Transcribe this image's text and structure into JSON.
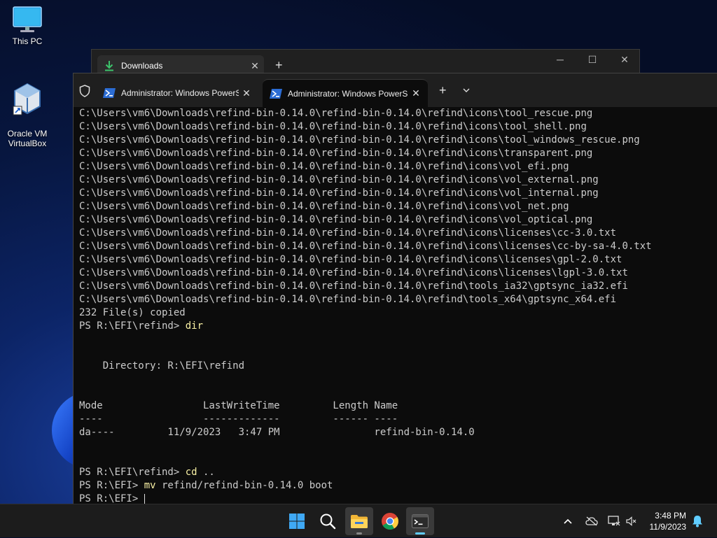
{
  "desktop": {
    "icons": [
      {
        "label": "This PC",
        "icon": "monitor-icon"
      },
      {
        "label": "Oracle VM\nVirtualBox",
        "icon": "virtualbox-icon"
      }
    ]
  },
  "explorer_window": {
    "tab_title": "Downloads",
    "tab_icon": "download-icon",
    "controls": {
      "minimize": "─",
      "maximize": "☐",
      "close": "✕"
    }
  },
  "terminal": {
    "tabs": [
      {
        "title": "Administrator: Windows PowerShell",
        "active": false
      },
      {
        "title": "Administrator: Windows PowerShell",
        "active": true
      }
    ],
    "new_tab_label": "+",
    "dropdown_label": "⌄",
    "lines": [
      {
        "text": "C:\\Users\\vm6\\Downloads\\refind-bin-0.14.0\\refind-bin-0.14.0\\refind\\icons\\tool_rescue.png"
      },
      {
        "text": "C:\\Users\\vm6\\Downloads\\refind-bin-0.14.0\\refind-bin-0.14.0\\refind\\icons\\tool_shell.png"
      },
      {
        "text": "C:\\Users\\vm6\\Downloads\\refind-bin-0.14.0\\refind-bin-0.14.0\\refind\\icons\\tool_windows_rescue.png"
      },
      {
        "text": "C:\\Users\\vm6\\Downloads\\refind-bin-0.14.0\\refind-bin-0.14.0\\refind\\icons\\transparent.png"
      },
      {
        "text": "C:\\Users\\vm6\\Downloads\\refind-bin-0.14.0\\refind-bin-0.14.0\\refind\\icons\\vol_efi.png"
      },
      {
        "text": "C:\\Users\\vm6\\Downloads\\refind-bin-0.14.0\\refind-bin-0.14.0\\refind\\icons\\vol_external.png"
      },
      {
        "text": "C:\\Users\\vm6\\Downloads\\refind-bin-0.14.0\\refind-bin-0.14.0\\refind\\icons\\vol_internal.png"
      },
      {
        "text": "C:\\Users\\vm6\\Downloads\\refind-bin-0.14.0\\refind-bin-0.14.0\\refind\\icons\\vol_net.png"
      },
      {
        "text": "C:\\Users\\vm6\\Downloads\\refind-bin-0.14.0\\refind-bin-0.14.0\\refind\\icons\\vol_optical.png"
      },
      {
        "text": "C:\\Users\\vm6\\Downloads\\refind-bin-0.14.0\\refind-bin-0.14.0\\refind\\icons\\licenses\\cc-3.0.txt"
      },
      {
        "text": "C:\\Users\\vm6\\Downloads\\refind-bin-0.14.0\\refind-bin-0.14.0\\refind\\icons\\licenses\\cc-by-sa-4.0.txt"
      },
      {
        "text": "C:\\Users\\vm6\\Downloads\\refind-bin-0.14.0\\refind-bin-0.14.0\\refind\\icons\\licenses\\gpl-2.0.txt"
      },
      {
        "text": "C:\\Users\\vm6\\Downloads\\refind-bin-0.14.0\\refind-bin-0.14.0\\refind\\icons\\licenses\\lgpl-3.0.txt"
      },
      {
        "text": "C:\\Users\\vm6\\Downloads\\refind-bin-0.14.0\\refind-bin-0.14.0\\refind\\tools_ia32\\gptsync_ia32.efi"
      },
      {
        "text": "C:\\Users\\vm6\\Downloads\\refind-bin-0.14.0\\refind-bin-0.14.0\\refind\\tools_x64\\gptsync_x64.efi"
      },
      {
        "text": "232 File(s) copied"
      },
      {
        "prompt": "PS R:\\EFI\\refind> ",
        "cmd": "dir"
      },
      {
        "text": ""
      },
      {
        "text": ""
      },
      {
        "text": "    Directory: R:\\EFI\\refind"
      },
      {
        "text": ""
      },
      {
        "text": ""
      },
      {
        "text": "Mode                 LastWriteTime         Length Name"
      },
      {
        "text": "----                 -------------         ------ ----"
      },
      {
        "text": "da----         11/9/2023   3:47 PM                refind-bin-0.14.0"
      },
      {
        "text": ""
      },
      {
        "text": ""
      },
      {
        "prompt": "PS R:\\EFI\\refind> ",
        "cmd": "cd",
        "args": " .."
      },
      {
        "prompt": "PS R:\\EFI> ",
        "cmd": "mv",
        "args": " refind/refind-bin-0.14.0 boot"
      },
      {
        "prompt": "PS R:\\EFI> ",
        "cmd": "",
        "cursor": true
      }
    ]
  },
  "taskbar": {
    "apps": [
      {
        "name": "start-button",
        "icon": "windows-logo-icon"
      },
      {
        "name": "search-button",
        "icon": "search-icon"
      },
      {
        "name": "file-explorer-button",
        "icon": "folder-icon"
      },
      {
        "name": "chrome-button",
        "icon": "chrome-icon"
      },
      {
        "name": "terminal-button",
        "icon": "terminal-icon"
      }
    ],
    "tray": {
      "time": "3:48 PM",
      "date": "11/9/2023"
    }
  },
  "colors": {
    "terminal_bg": "#0c0c0c",
    "terminal_text": "#cccccc",
    "command_text": "#f9f1a5",
    "taskbar_bg": "#1c1c1c",
    "accent": "#60cdff"
  }
}
